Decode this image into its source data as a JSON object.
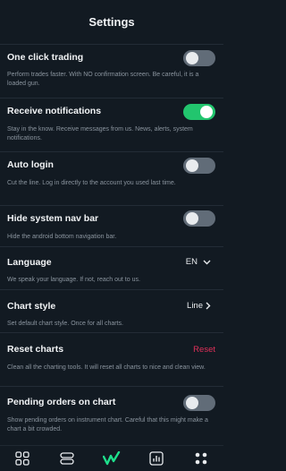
{
  "header": {
    "title": "Settings"
  },
  "settings": {
    "one_click": {
      "title": "One click trading",
      "desc": "Perform trades faster. With NO confirmation screen. Be careful, it is a loaded gun.",
      "on": false
    },
    "notifications": {
      "title": "Receive notifications",
      "desc": "Stay in the know. Receive messages from us. News, alerts, system notifications.",
      "on": true
    },
    "auto_login": {
      "title": "Auto login",
      "desc": "Cut the line. Log in directly to the account you used last time.",
      "on": false
    },
    "hide_nav": {
      "title": "Hide system nav bar",
      "desc": "Hide the android bottom navigation bar.",
      "on": false
    },
    "language": {
      "title": "Language",
      "desc": "We speak your language. If not, reach out to us.",
      "value": "EN"
    },
    "chart_style": {
      "title": "Chart style",
      "desc": "Set default chart style. Once for all charts.",
      "value": "Line"
    },
    "reset_charts": {
      "title": "Reset charts",
      "desc": "Clean all the charting tools. It will reset all charts to nice and clean view.",
      "action": "Reset"
    },
    "pending_orders": {
      "title": "Pending orders on chart",
      "desc": "Show pending orders on instrument chart. Careful that this might make a chart a bit crowded.",
      "on": false
    }
  },
  "bottom_nav": {
    "items": [
      {
        "icon": "grid-icon"
      },
      {
        "icon": "list-icon"
      },
      {
        "icon": "brand-logo-icon"
      },
      {
        "icon": "chart-icon"
      },
      {
        "icon": "more-icon"
      }
    ]
  },
  "colors": {
    "background": "#121a22",
    "toggle_on": "#22c56e",
    "toggle_off": "#616c78",
    "reset": "#e0305a",
    "brand": "#1ee08c"
  }
}
